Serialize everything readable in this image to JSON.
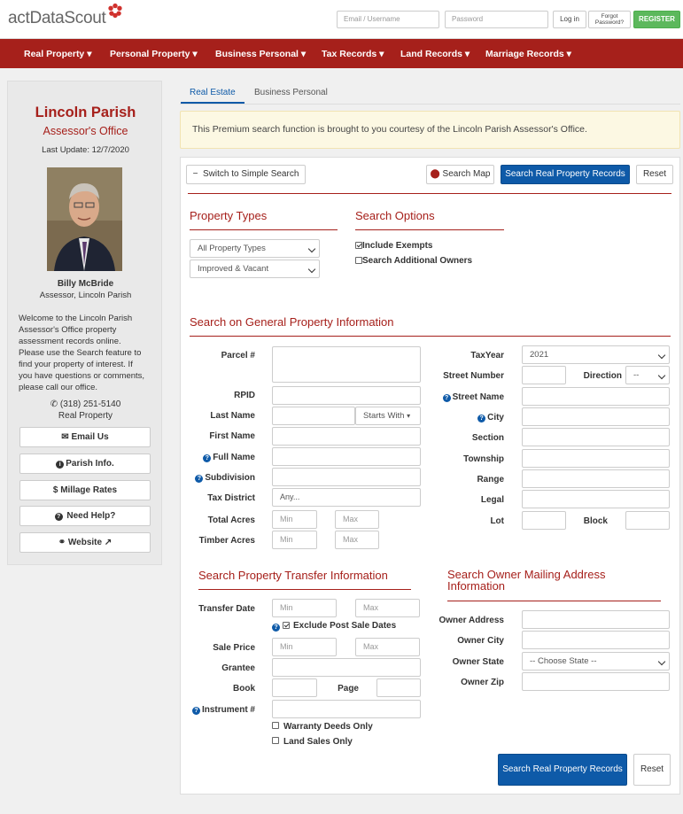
{
  "header": {
    "logo_text": "actDataScout",
    "email_placeholder": "Email / Username",
    "password_placeholder": "Password",
    "login_label": "Log in",
    "forgot_label_1": "Forgot",
    "forgot_label_2": "Password?",
    "register_label": "REGISTER"
  },
  "nav": [
    "Real Property",
    "Personal Property",
    "Business Personal",
    "Tax Records",
    "Land Records",
    "Marriage Records"
  ],
  "sidebar": {
    "parish": "Lincoln Parish",
    "office": "Assessor's Office",
    "last_update": "Last Update: 12/7/2020",
    "name": "Billy McBride",
    "title": "Assessor, Lincoln Parish",
    "welcome": [
      "Welcome to the Lincoln Parish",
      "Assessor's Office property",
      "assessment records online.",
      "Please use the Search feature to",
      "find your property of interest. If",
      "you have questions or comments,",
      "please call our office."
    ],
    "phone": "(318) 251-5140",
    "phone_sub": "Real Property",
    "buttons": [
      "Email Us",
      "Parish Info.",
      "Millage Rates",
      "Need Help?",
      "Website"
    ]
  },
  "tabs": [
    "Real Estate",
    "Business Personal"
  ],
  "notice": "This Premium search function is brought to you courtesy of the Lincoln Parish Assessor's Office.",
  "toolbar": {
    "simple_search": "Switch to Simple Search",
    "search_map": "Search Map",
    "search_records": "Search Real Property Records",
    "reset": "Reset"
  },
  "property_types": {
    "heading": "Property Types",
    "select1": "All Property Types",
    "select2": "Improved & Vacant"
  },
  "search_options": {
    "heading": "Search Options",
    "include_exempts": "Include Exempts",
    "include_exempts_checked": true,
    "additional_owners": "Search Additional Owners",
    "additional_owners_checked": false
  },
  "general": {
    "heading": "Search on General Property Information",
    "labels": {
      "parcel": "Parcel #",
      "rpid": "RPID",
      "last_name": "Last Name",
      "first_name": "First Name",
      "full_name": "Full Name",
      "subdivision": "Subdivision",
      "tax_district": "Tax District",
      "total_acres": "Total Acres",
      "timber_acres": "Timber Acres",
      "tax_year": "TaxYear",
      "street_number": "Street Number",
      "direction": "Direction",
      "street_name": "Street Name",
      "city": "City",
      "section": "Section",
      "township": "Township",
      "range": "Range",
      "legal": "Legal",
      "lot": "Lot",
      "block": "Block"
    },
    "last_name_mode": "Starts With",
    "tax_district_value": "Any...",
    "min_placeholder": "Min",
    "max_placeholder": "Max",
    "tax_year_value": "2021",
    "direction_value": "--"
  },
  "transfer": {
    "heading": "Search Property Transfer Information",
    "transfer_date": "Transfer Date",
    "exclude_post": "Exclude Post Sale Dates",
    "sale_price": "Sale Price",
    "grantee": "Grantee",
    "book": "Book",
    "page": "Page",
    "instrument": "Instrument #",
    "warranty": "Warranty Deeds Only",
    "land_sales": "Land Sales Only"
  },
  "owner": {
    "heading_1": "Search Owner Mailing Address",
    "heading_2": "Information",
    "address": "Owner Address",
    "city": "Owner City",
    "state": "Owner State",
    "state_value": "-- Choose State --",
    "zip": "Owner Zip"
  },
  "bottom": {
    "search": "Search Real Property Records",
    "reset": "Reset"
  },
  "colors": {
    "brand": "#a6201b",
    "primary": "#0e5aa8",
    "register": "#5cb85c"
  }
}
